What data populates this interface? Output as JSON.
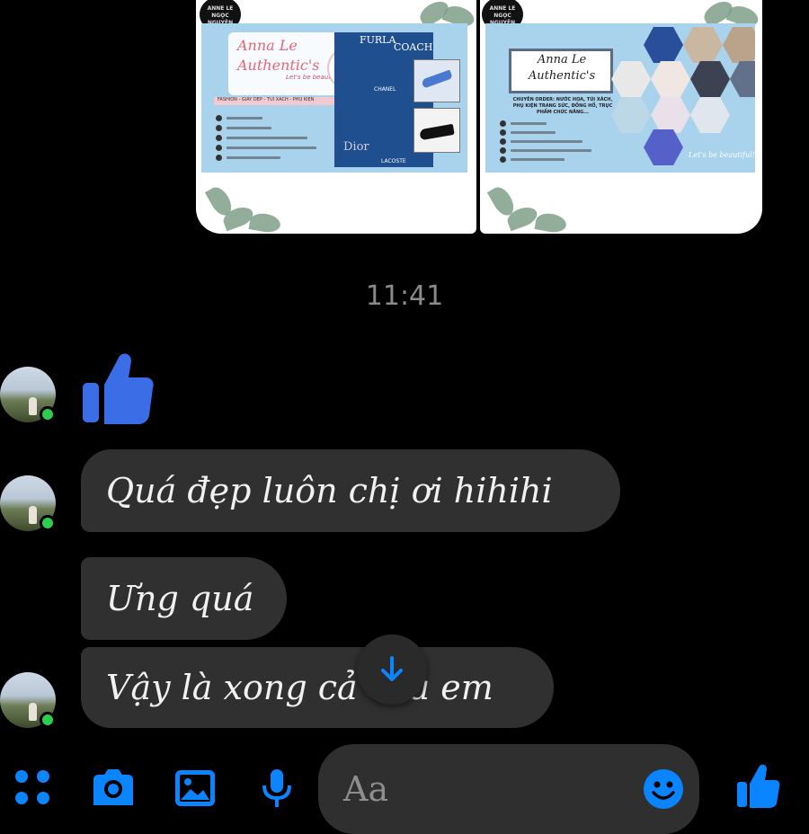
{
  "shared_images": {
    "left": {
      "logo_text": "ANNE LE\nNGỌC NGUYÊN",
      "brand_name": "Anna Le\nAuthentic's",
      "tagline": "Let's be beautiful!",
      "category_bar": "FASHION - GIÀY DÉP - TÚI XÁCH - PHỤ KIỆN",
      "brands": [
        "FURLA",
        "COACH",
        "CHANEL",
        "Dior",
        "LACOSTE"
      ]
    },
    "right": {
      "logo_text": "ANNE LE\nNGỌC NGUYÊN",
      "brand_name": "Anna Le\nAuthentic's",
      "services": "CHUYÊN ORDER: NƯỚC HOA, TÚI XÁCH,\nPHỤ KIỆN TRANG SỨC, ĐỒNG HỒ, TRỤC\nPHẨM CHỨC NĂNG...",
      "tagline": "Let's be beautiful!"
    }
  },
  "timestamp": "11:41",
  "messages": [
    {
      "type": "like"
    },
    {
      "type": "text",
      "text": "Quá đẹp luôn chị ơi hihihi"
    },
    {
      "type": "text",
      "text": "Ưng quá"
    },
    {
      "type": "text",
      "text": "Vậy là xong cả của em"
    }
  ],
  "composer": {
    "placeholder": "Aa"
  },
  "colors": {
    "accent": "#0a84ff",
    "bubble": "#303030",
    "online": "#2fcd4f",
    "like": "#3b6ee6"
  }
}
